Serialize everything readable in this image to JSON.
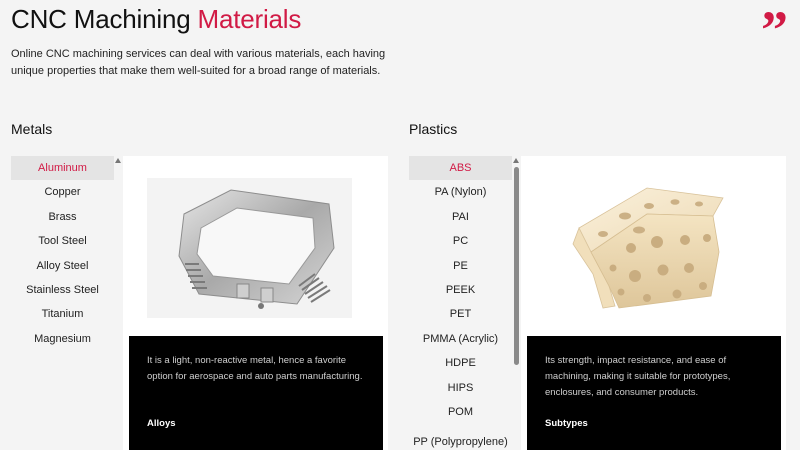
{
  "page": {
    "title_main": "CNC Machining ",
    "title_accent": "Materials",
    "intro": "Online CNC machining services can deal with various materials, each having unique properties that make them well-suited for a broad range of materials.",
    "accent_color": "#d11a45",
    "quote_icon": "quote-icon"
  },
  "metals": {
    "heading": "Metals",
    "items": [
      "Aluminum",
      "Copper",
      "Brass",
      "Tool Steel",
      "Alloy Steel",
      "Stainless Steel",
      "Titanium",
      "Magnesium"
    ],
    "selected": "Aluminum",
    "image": "aluminum-part-image",
    "description": "It is a light, non-reactive metal, hence a favorite option for aerospace and auto parts manufacturing.",
    "sub_label": "Alloys"
  },
  "plastics": {
    "heading": "Plastics",
    "items": [
      "ABS",
      "PA (Nylon)",
      "PAI",
      "PC",
      "PE",
      "PEEK",
      "PET",
      "PMMA (Acrylic)",
      "HDPE",
      "HIPS",
      "POM",
      "PP (Polypropylene)"
    ],
    "selected": "ABS",
    "image": "abs-part-image",
    "description": "Its strength, impact resistance, and ease of machining, making it suitable for prototypes, enclosures, and consumer products.",
    "sub_label": "Subtypes"
  }
}
